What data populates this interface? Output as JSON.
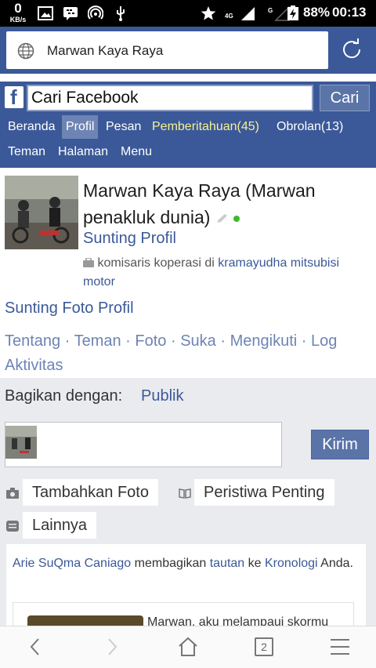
{
  "status_bar": {
    "net_speed_value": "0",
    "net_speed_unit": "KB/s",
    "battery": "88%",
    "time": "00:13",
    "network_4g": "4G",
    "sim_g": "G"
  },
  "url_bar": {
    "text": "Marwan Kaya Raya"
  },
  "fb_header": {
    "search_value": "Cari Facebook",
    "search_button": "Cari",
    "nav_row1": [
      "Beranda",
      "Profil",
      "Pesan",
      "Pemberitahuan(45)",
      "Obrolan(13)"
    ],
    "nav_row2": [
      "Teman",
      "Halaman",
      "Menu"
    ]
  },
  "profile": {
    "name": "Marwan Kaya Raya (Marwan penakluk dunia)",
    "edit_profile": "Sunting Profil",
    "work_prefix": "komisaris koperasi di",
    "work_company": "kramayudha mitsubisi motor",
    "edit_photo": "Sunting Foto Profil",
    "tabs": [
      "Tentang",
      "Teman",
      "Foto",
      "Suka",
      "Mengikuti",
      "Log Aktivitas"
    ]
  },
  "share": {
    "label": "Bagikan dengan:",
    "audience": "Publik",
    "send_button": "Kirim",
    "add_photo": "Tambahkan Foto",
    "life_event": "Peristiwa Penting",
    "more": "Lainnya"
  },
  "story": {
    "actor": "Arie SuQma Caniago",
    "verb": "membagikan",
    "object": "tautan",
    "to": "ke",
    "timeline": "Kronologi",
    "you": "Anda.",
    "snippet": "Marwan, aku melampaui skormu"
  },
  "bottom_nav": {
    "tab_count": "2"
  },
  "colors": {
    "fb_blue": "#3b5998",
    "notif_yellow": "#f7f192",
    "online_green": "#42b72a"
  }
}
